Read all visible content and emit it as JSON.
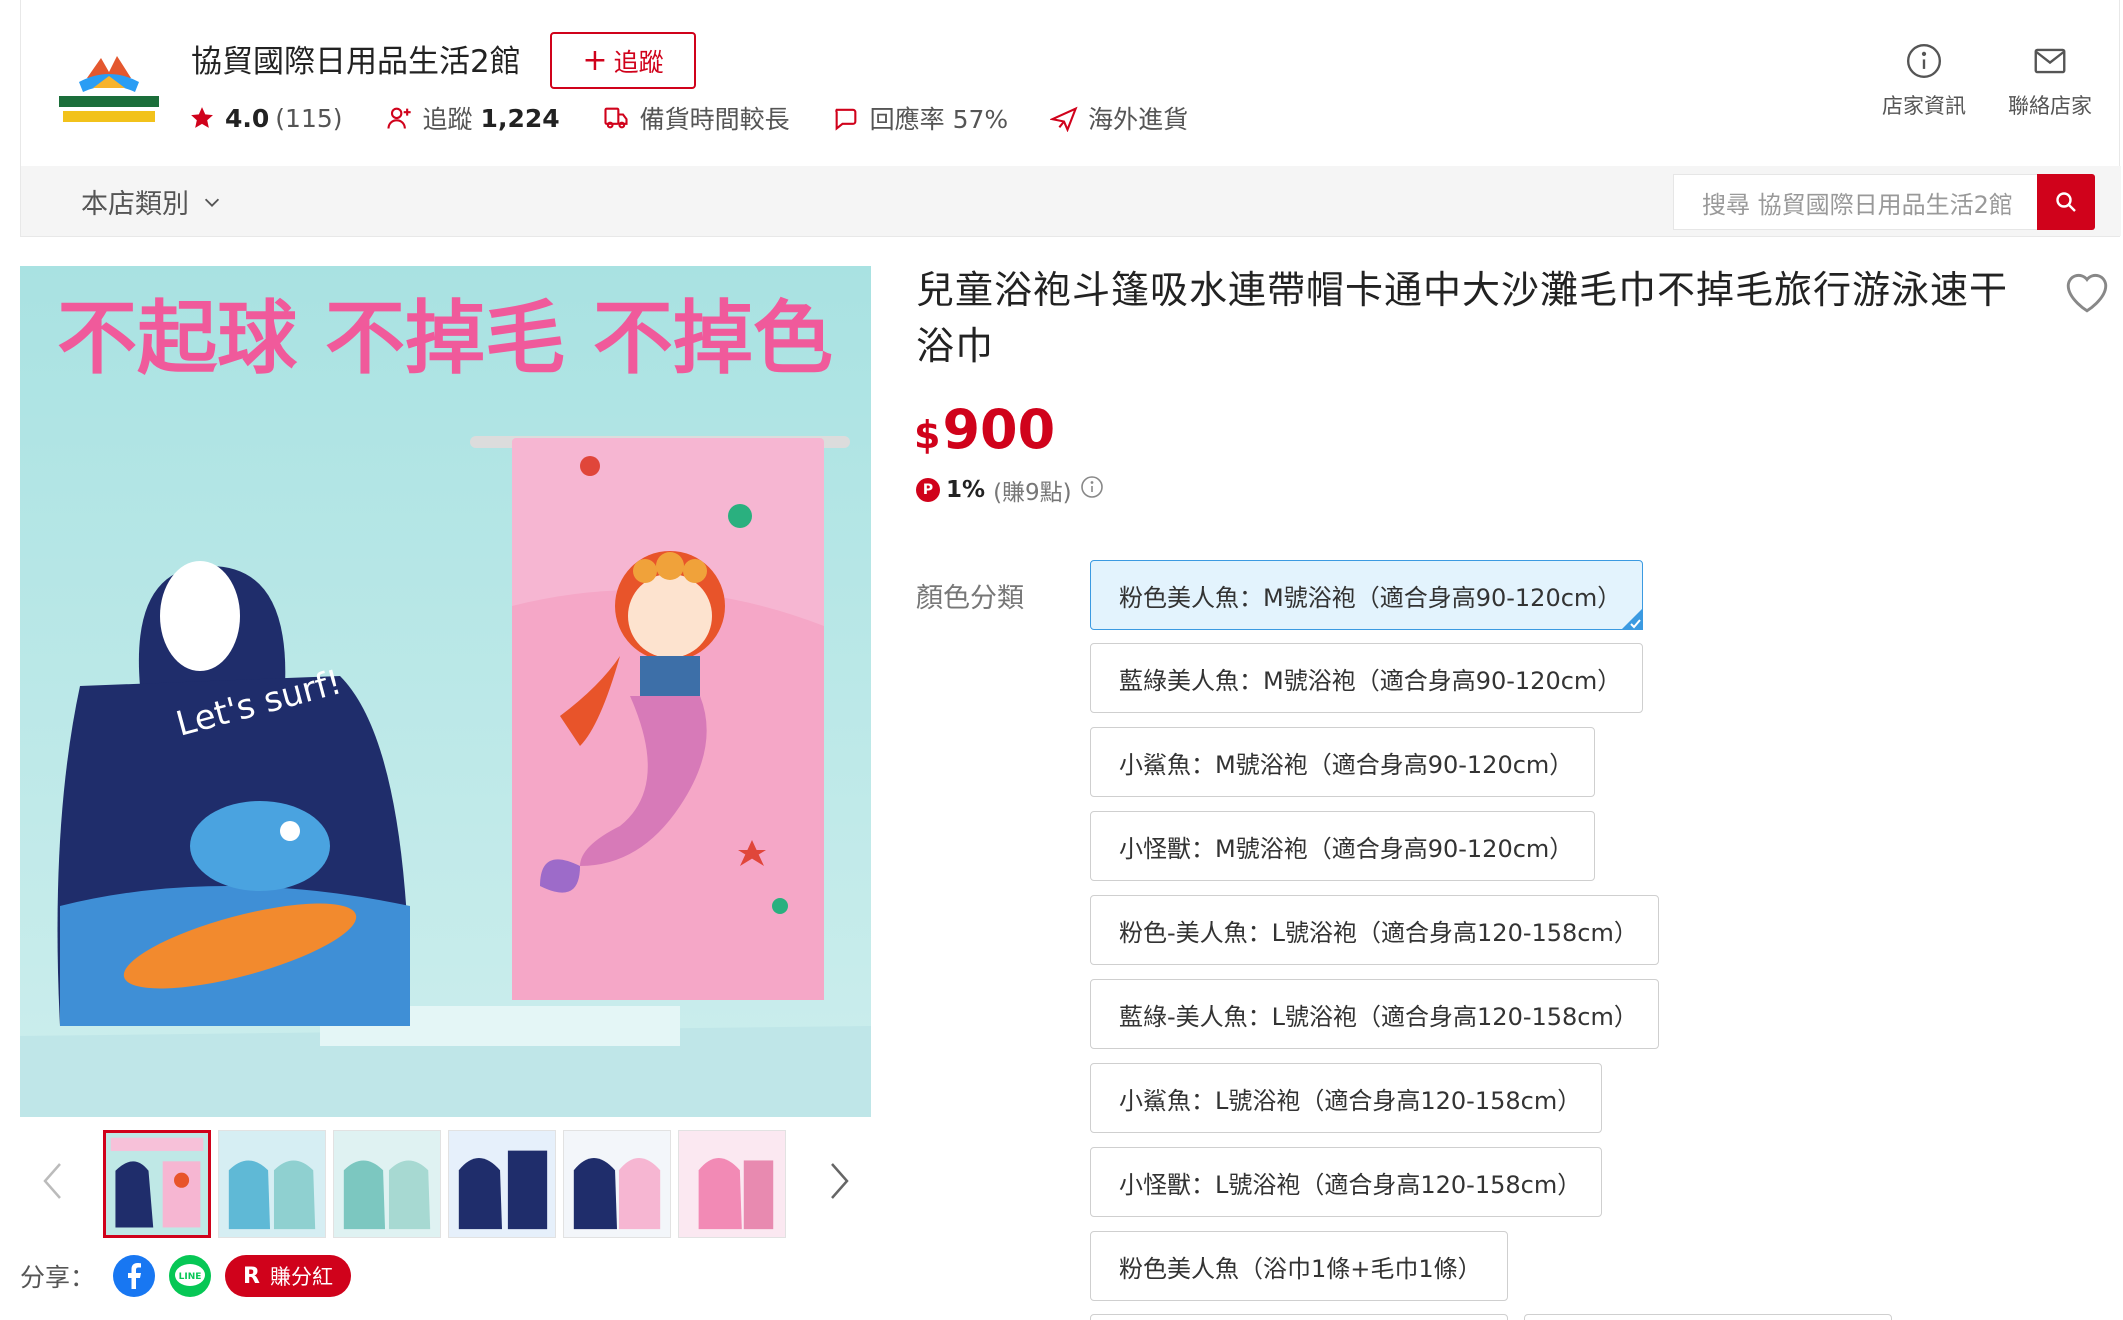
{
  "store": {
    "name": "協貿國際日用品生活2館",
    "follow_label": "追蹤",
    "rating": "4.0",
    "rating_count": "(115)",
    "followers_label": "追蹤",
    "followers_count": "1,224",
    "prep_time": "備貨時間較長",
    "response_rate": "回應率 57%",
    "overseas": "海外進貨",
    "info_label": "店家資訊",
    "contact_label": "聯絡店家"
  },
  "nav": {
    "category_label": "本店類別",
    "search_placeholder": "搜尋 協貿國際日用品生活2館"
  },
  "gallery": {
    "image_slogan": "不起球  不掉毛  不掉色",
    "thumbnail_count": 6
  },
  "share": {
    "label": "分享：",
    "line_text": "LINE",
    "earn_label": "賺分紅",
    "earn_icon": "R"
  },
  "product": {
    "title": "兒童浴袍斗篷吸水連帶帽卡通中大沙灘毛巾不掉毛旅行游泳速干浴巾",
    "currency": "$",
    "price": "900",
    "points_badge": "P",
    "points_pct": "1%",
    "points_text": "(賺9點)"
  },
  "variants": {
    "label": "顏色分類",
    "options": [
      "粉色美人魚：M號浴袍（適合身高90-120cm）",
      "藍綠美人魚：M號浴袍（適合身高90-120cm）",
      "小鯊魚：M號浴袍（適合身高90-120cm）",
      "小怪獸：M號浴袍（適合身高90-120cm）",
      "粉色-美人魚：L號浴袍（適合身高120-158cm）",
      "藍綠-美人魚：L號浴袍（適合身高120-158cm）",
      "小鯊魚：L號浴袍（適合身高120-158cm）",
      "小怪獸：L號浴袍（適合身高120-158cm）",
      "粉色美人魚（浴巾1條+毛巾1條）"
    ],
    "selected_index": 0
  },
  "colors": {
    "accent": "#d0021b",
    "selected_border": "#3b9ae1",
    "selected_bg": "#e3f3fd"
  }
}
